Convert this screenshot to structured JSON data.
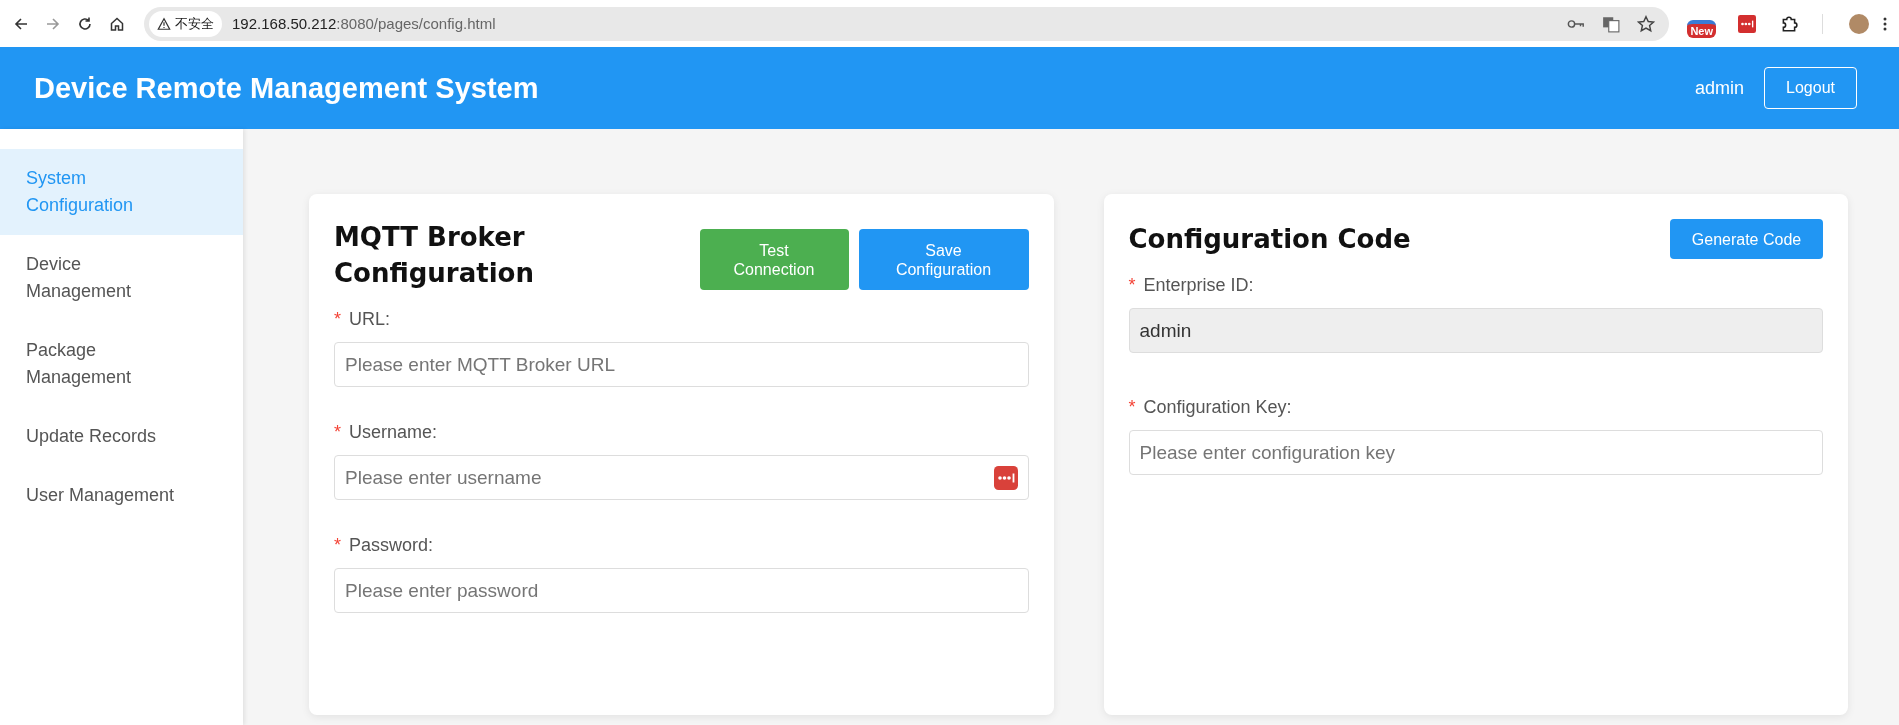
{
  "browser": {
    "security_label": "不安全",
    "url_host": "192.168.50.212",
    "url_path": ":8080/pages/config.html",
    "extension_badge": "New"
  },
  "header": {
    "title": "Device Remote Management System",
    "user": "admin",
    "logout": "Logout"
  },
  "sidebar": {
    "items": [
      {
        "label": "System Configuration",
        "selected": true
      },
      {
        "label": "Device Management",
        "selected": false
      },
      {
        "label": "Package Management",
        "selected": false
      },
      {
        "label": "Update Records",
        "selected": false
      },
      {
        "label": "User Management",
        "selected": false
      }
    ]
  },
  "mqtt_card": {
    "title": "MQTT Broker Configuration",
    "buttons": [
      {
        "label": "Test Connection",
        "kind": "success"
      },
      {
        "label": "Save Configuration",
        "kind": "primary"
      }
    ],
    "fields": [
      {
        "marker": "*",
        "label": "URL:",
        "placeholder": "Please enter MQTT Broker URL",
        "autofill_icon": false
      },
      {
        "marker": "*",
        "label": "Username:",
        "placeholder": "Please enter username",
        "autofill_icon": true
      },
      {
        "marker": "*",
        "label": "Password:",
        "placeholder": "Please enter password",
        "autofill_icon": false
      }
    ]
  },
  "code_card": {
    "title": "Configuration Code",
    "button": "Generate Code",
    "fields": [
      {
        "marker": "*",
        "label": "Enterprise ID:",
        "value": "admin",
        "disabled": true
      },
      {
        "marker": "*",
        "label": "Configuration Key:",
        "placeholder": "Please enter configuration key",
        "disabled": false
      }
    ]
  }
}
